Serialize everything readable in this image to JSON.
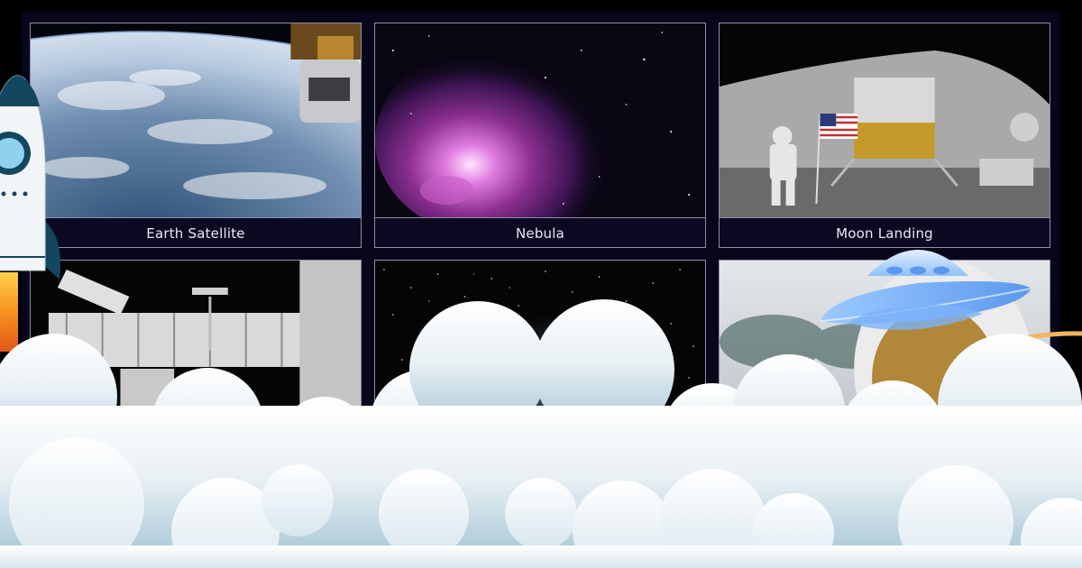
{
  "gallery": {
    "cards": [
      {
        "caption": "Earth Satellite",
        "image": "earth-satellite-photo"
      },
      {
        "caption": "Nebula",
        "image": "nebula-photo"
      },
      {
        "caption": "Moon Landing",
        "image": "moon-landing-photo"
      },
      {
        "caption": "",
        "image": "space-station-photo"
      },
      {
        "caption": "",
        "image": "star-field-photo"
      },
      {
        "caption": "",
        "image": "astronaut-helmet-photo"
      }
    ]
  },
  "decorations": {
    "rocket": "rocket-icon",
    "ufo": "ufo-icon",
    "clouds": "cloud-bank"
  },
  "colors": {
    "page_background": "#000000",
    "panel_background": "#07061a",
    "card_border": "#8f8da8",
    "caption_text": "#e9e9f3",
    "ufo_blue": "#6ea9f5",
    "rocket_body": "#f2f5f8",
    "rocket_accent": "#12475f",
    "flame_orange": "#f7931e"
  }
}
